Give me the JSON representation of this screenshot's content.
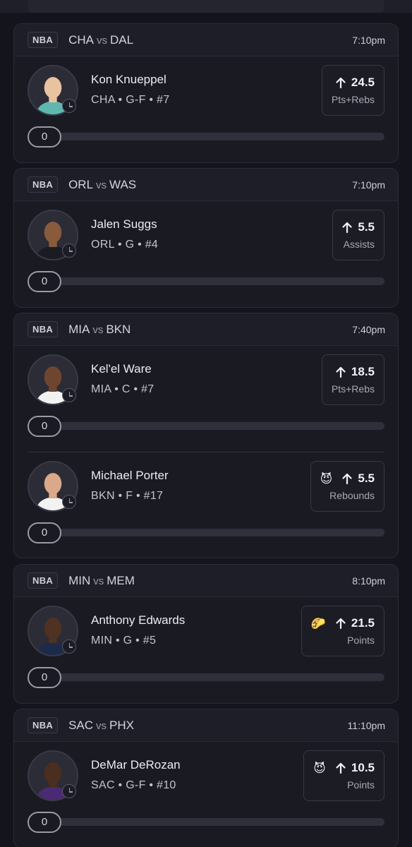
{
  "cards": [
    {
      "league": "NBA",
      "home": "CHA",
      "vs": "vs",
      "away": "DAL",
      "time": "7:10pm",
      "picks": [
        {
          "name": "Kon Knueppel",
          "meta": "CHA • G-F • #7",
          "line": "24.5",
          "stat": "Pts+Rebs",
          "emoji": "",
          "progress": "0",
          "jersey": "#5fb8b0"
        }
      ]
    },
    {
      "league": "NBA",
      "home": "ORL",
      "vs": "vs",
      "away": "WAS",
      "time": "7:10pm",
      "picks": [
        {
          "name": "Jalen Suggs",
          "meta": "ORL • G • #4",
          "line": "5.5",
          "stat": "Assists",
          "emoji": "",
          "progress": "0",
          "jersey": "#1b1b22"
        }
      ]
    },
    {
      "league": "NBA",
      "home": "MIA",
      "vs": "vs",
      "away": "BKN",
      "time": "7:40pm",
      "picks": [
        {
          "name": "Kel'el Ware",
          "meta": "MIA • C • #7",
          "line": "18.5",
          "stat": "Pts+Rebs",
          "emoji": "",
          "progress": "0",
          "jersey": "#f2f2f2"
        },
        {
          "name": "Michael Porter",
          "meta": "BKN • F • #17",
          "line": "5.5",
          "stat": "Rebounds",
          "emoji": "😈",
          "progress": "0",
          "jersey": "#f2f2f2"
        }
      ]
    },
    {
      "league": "NBA",
      "home": "MIN",
      "vs": "vs",
      "away": "MEM",
      "time": "8:10pm",
      "picks": [
        {
          "name": "Anthony Edwards",
          "meta": "MIN • G • #5",
          "line": "21.5",
          "stat": "Points",
          "emoji": "🌮",
          "progress": "0",
          "jersey": "#1d2b4a"
        }
      ]
    },
    {
      "league": "NBA",
      "home": "SAC",
      "vs": "vs",
      "away": "PHX",
      "time": "11:10pm",
      "picks": [
        {
          "name": "DeMar DeRozan",
          "meta": "SAC • G-F • #10",
          "line": "10.5",
          "stat": "Points",
          "emoji": "😈",
          "progress": "0",
          "jersey": "#4b2a74"
        }
      ]
    }
  ]
}
